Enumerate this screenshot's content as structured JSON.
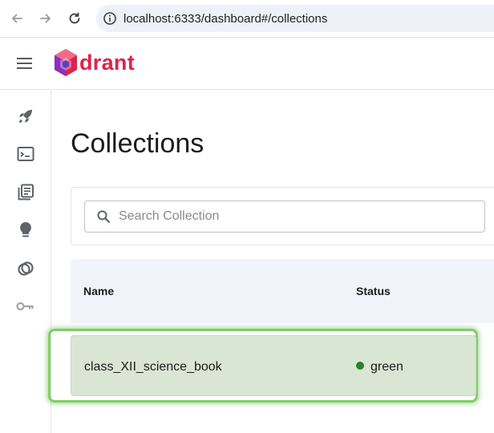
{
  "browser": {
    "url": "localhost:6333/dashboard#/collections"
  },
  "header": {
    "logo_text": "drant"
  },
  "sidebar": {
    "items": [
      {
        "icon": "rocket-icon"
      },
      {
        "icon": "console-icon"
      },
      {
        "icon": "collections-icon"
      },
      {
        "icon": "lightbulb-icon"
      },
      {
        "icon": "datasets-icon"
      },
      {
        "icon": "key-icon"
      }
    ]
  },
  "main": {
    "title": "Collections",
    "search": {
      "placeholder": "Search Collection"
    },
    "table": {
      "columns": [
        "Name",
        "Status"
      ],
      "rows": [
        {
          "name": "class_XII_science_book",
          "status": "green",
          "status_color": "#2e7d32"
        }
      ]
    }
  },
  "colors": {
    "brand_red": "#dc244c",
    "highlight_border": "#7fcf63",
    "row_bg": "#d9e6d4",
    "table_head_bg": "#f0f4fa"
  }
}
